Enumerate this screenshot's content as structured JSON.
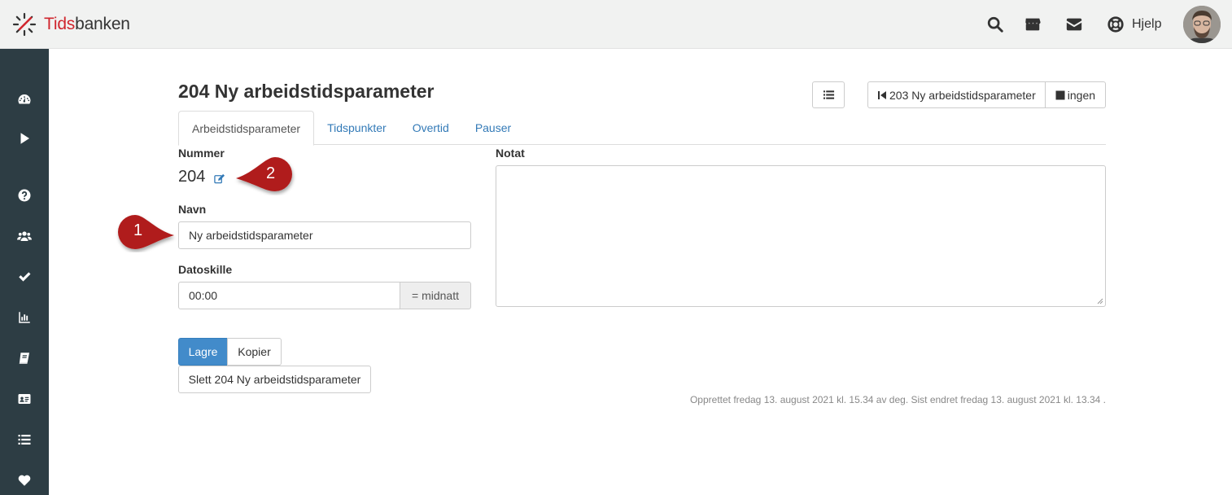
{
  "brand": {
    "name_part1": "Tids",
    "name_part2": "banken",
    "accent": "#d0262e"
  },
  "topbar": {
    "icons": [
      "search-icon",
      "store-icon",
      "mail-icon",
      "lifebuoy-icon"
    ],
    "help_label": "Hjelp"
  },
  "sidebar": {
    "background": "#2d3d44",
    "items": [
      "dashboard-icon",
      "play-icon",
      "question-icon",
      "users-icon",
      "check-icon",
      "bar-chart-icon",
      "book-icon",
      "id-card-icon",
      "list-icon",
      "heart-icon"
    ]
  },
  "page": {
    "title": "204 Ny arbeidstidsparameter",
    "prev_label": "203 Ny arbeidstidsparameter",
    "next_label": "ingen"
  },
  "tabs": [
    {
      "label": "Arbeidstidsparameter",
      "active": true
    },
    {
      "label": "Tidspunkter",
      "active": false
    },
    {
      "label": "Overtid",
      "active": false
    },
    {
      "label": "Pauser",
      "active": false
    }
  ],
  "form": {
    "number_label": "Nummer",
    "number_value": "204",
    "name_label": "Navn",
    "name_value": "Ny arbeidstidsparameter",
    "date_split_label": "Datoskille",
    "date_split_value": "00:00",
    "date_split_addon": "= midnatt",
    "note_label": "Notat",
    "note_value": ""
  },
  "actions": {
    "save_label": "Lagre",
    "copy_label": "Kopier",
    "delete_label": "Slett 204 Ny arbeidstidsparameter"
  },
  "meta_text": "Opprettet fredag 13. august 2021 kl. 15.34 av deg. Sist endret fredag 13. august 2021 kl. 13.34 .",
  "callouts": [
    {
      "number": "1",
      "color": "#b01e1e"
    },
    {
      "number": "2",
      "color": "#b01e1e"
    }
  ]
}
